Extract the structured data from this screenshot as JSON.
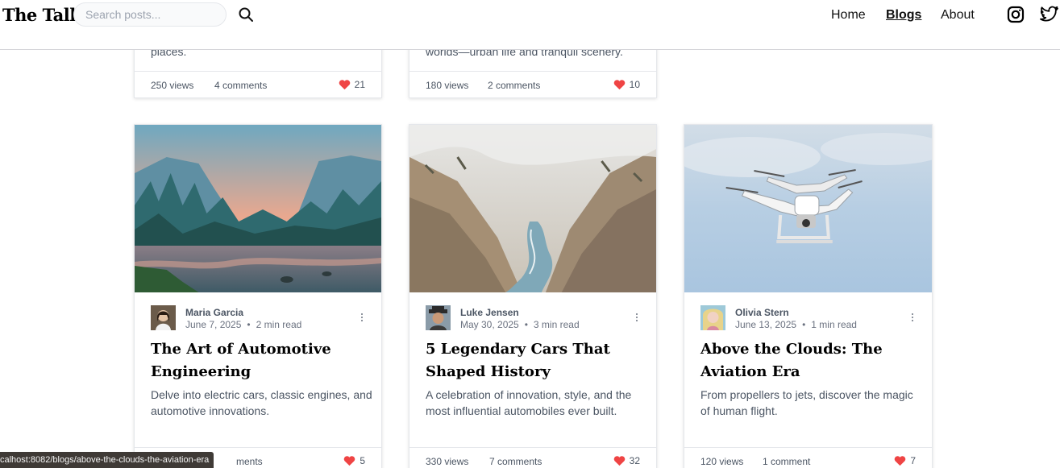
{
  "header": {
    "brand": "The Talk",
    "search_placeholder": "Search posts...",
    "nav": [
      {
        "label": "Home",
        "active": false
      },
      {
        "label": "Blogs",
        "active": true
      },
      {
        "label": "About",
        "active": false
      }
    ],
    "social_icons": [
      "instagram-icon",
      "twitter-icon"
    ]
  },
  "top_cards": [
    {
      "excerpt_tail": "places.",
      "views": "250 views",
      "comments": "4 comments",
      "likes": "21"
    },
    {
      "excerpt_tail": "worlds—urban life and tranquil scenery.",
      "views": "180 views",
      "comments": "2 comments",
      "likes": "10"
    }
  ],
  "cards": [
    {
      "image": "mountain-lake-landscape",
      "author": "Maria Garcia",
      "date": "June 7, 2025",
      "read_time": "2 min read",
      "title": "The Art of Automotive Engineering",
      "excerpt": "Delve into electric cars, classic engines, and automotive innovations.",
      "views": "",
      "comments": "ments",
      "likes": "5"
    },
    {
      "image": "river-canyon",
      "author": "Luke Jensen",
      "date": "May 30, 2025",
      "read_time": "3 min read",
      "title": "5 Legendary Cars That Shaped History",
      "excerpt": "A celebration of innovation, style, and the most influential automobiles ever built.",
      "views": "330 views",
      "comments": "7 comments",
      "likes": "32"
    },
    {
      "image": "drone-in-sky",
      "author": "Olivia Stern",
      "date": "June 13, 2025",
      "read_time": "1 min read",
      "title": "Above the Clouds: The Aviation Era",
      "excerpt": "From propellers to jets, discover the magic of human flight.",
      "views": "120 views",
      "comments": "1 comment",
      "likes": "7"
    }
  ],
  "status_bar": {
    "url": "calhost:8082/blogs/above-the-clouds-the-aviation-era"
  },
  "colors": {
    "heart": "#ef4444",
    "text_muted": "#6b7280",
    "border": "#e5e7eb"
  }
}
